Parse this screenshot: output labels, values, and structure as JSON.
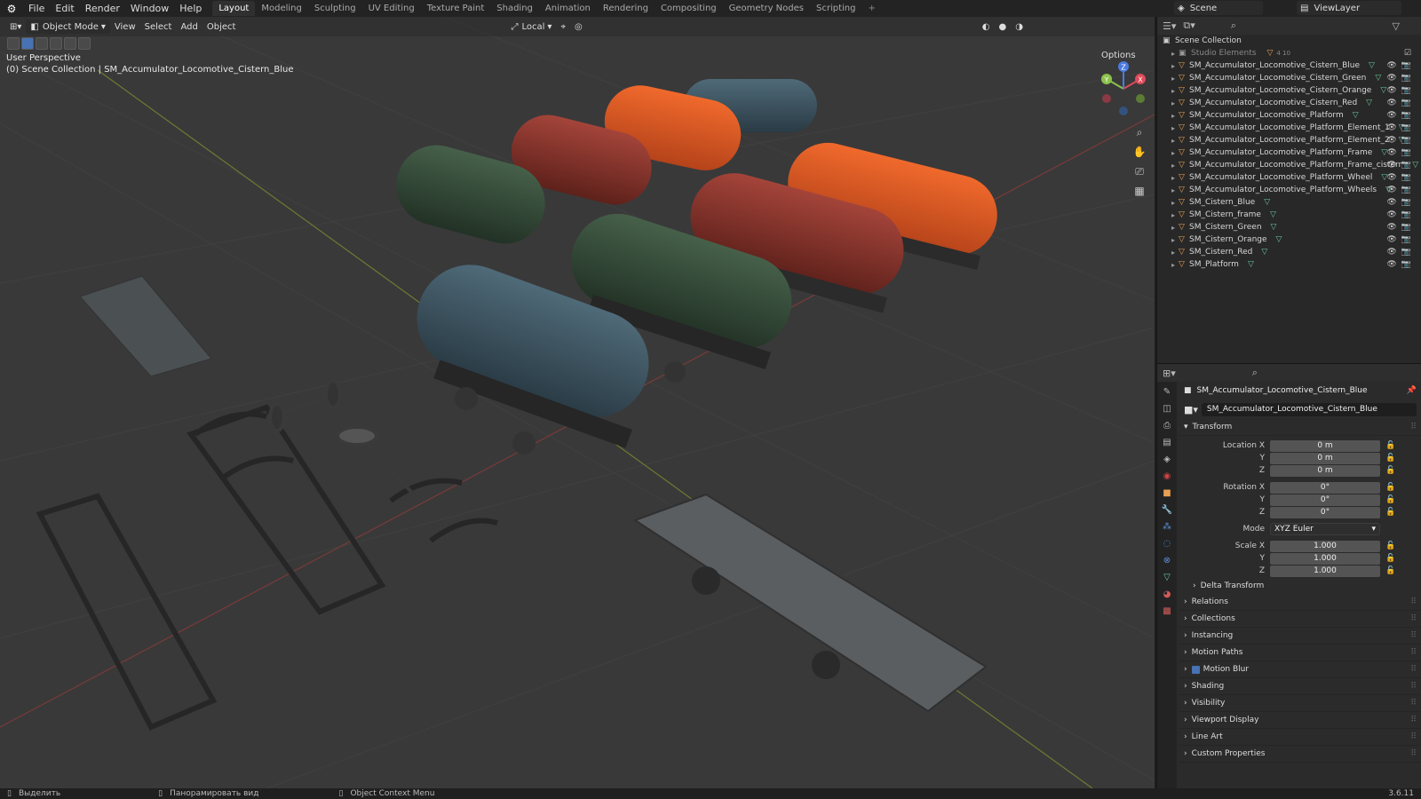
{
  "menu": {
    "items": [
      "File",
      "Edit",
      "Render",
      "Window",
      "Help"
    ]
  },
  "workspaces": [
    "Layout",
    "Modeling",
    "Sculpting",
    "UV Editing",
    "Texture Paint",
    "Shading",
    "Animation",
    "Rendering",
    "Compositing",
    "Geometry Nodes",
    "Scripting"
  ],
  "active_workspace": "Layout",
  "scene": {
    "label": "Scene"
  },
  "viewlayer": {
    "label": "ViewLayer"
  },
  "viewport": {
    "mode": "Object Mode",
    "menus": [
      "View",
      "Select",
      "Add",
      "Object"
    ],
    "transform_space": "Local",
    "options": "Options",
    "perspective": "User Perspective",
    "collection_info": "(0) Scene Collection | SM_Accumulator_Locomotive_Cistern_Blue",
    "gizmo_axes": {
      "x": "X",
      "y": "Y",
      "z": "Z"
    }
  },
  "outliner": {
    "root": "Scene Collection",
    "studio": "Studio Elements",
    "studio_counts": "4 10",
    "items": [
      "SM_Accumulator_Locomotive_Cistern_Blue",
      "SM_Accumulator_Locomotive_Cistern_Green",
      "SM_Accumulator_Locomotive_Cistern_Orange",
      "SM_Accumulator_Locomotive_Cistern_Red",
      "SM_Accumulator_Locomotive_Platform",
      "SM_Accumulator_Locomotive_Platform_Element_1",
      "SM_Accumulator_Locomotive_Platform_Element_2",
      "SM_Accumulator_Locomotive_Platform_Frame",
      "SM_Accumulator_Locomotive_Platform_Frame_cistern",
      "SM_Accumulator_Locomotive_Platform_Wheel",
      "SM_Accumulator_Locomotive_Platform_Wheels",
      "SM_Cistern_Blue",
      "SM_Cistern_frame",
      "SM_Cistern_Green",
      "SM_Cistern_Orange",
      "SM_Cistern_Red",
      "SM_Platform"
    ]
  },
  "properties": {
    "object_name": "SM_Accumulator_Locomotive_Cistern_Blue",
    "data_name": "SM_Accumulator_Locomotive_Cistern_Blue",
    "transform": {
      "title": "Transform",
      "location_label": "Location X",
      "loc_x": "0 m",
      "loc_y": "0 m",
      "loc_z": "0 m",
      "rotation_label": "Rotation X",
      "rot_x": "0°",
      "rot_y": "0°",
      "rot_z": "0°",
      "mode_label": "Mode",
      "mode_value": "XYZ Euler",
      "scale_label": "Scale X",
      "scale_x": "1.000",
      "scale_y": "1.000",
      "scale_z": "1.000",
      "y_label": "Y",
      "z_label": "Z",
      "delta": "Delta Transform"
    },
    "sections": [
      "Relations",
      "Collections",
      "Instancing",
      "Motion Paths",
      "Motion Blur",
      "Shading",
      "Visibility",
      "Viewport Display",
      "Line Art",
      "Custom Properties"
    ]
  },
  "status": {
    "select": "Выделить",
    "pan": "Панорамировать вид",
    "context": "Object Context Menu",
    "version": "3.6.11"
  },
  "colors": {
    "accent": "#4772b3",
    "viewport_bg": "#393939",
    "cistern_blue": "#3d5563",
    "cistern_green": "#35493a",
    "cistern_orange": "#d4541f",
    "cistern_red": "#8a3328"
  }
}
